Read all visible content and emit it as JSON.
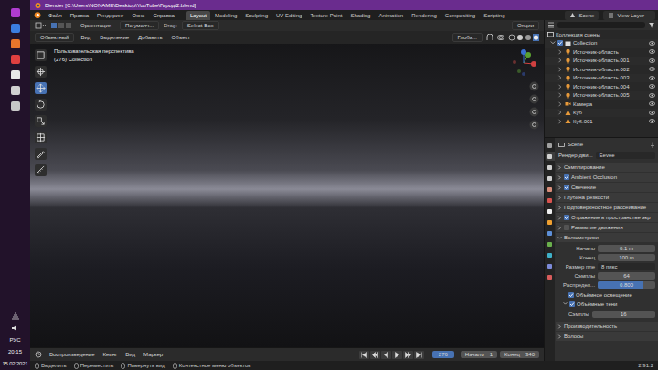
{
  "taskbar": {
    "language": "РУС",
    "time": "20:15",
    "date": "15.02.2021"
  },
  "window": {
    "title": "Blender [C:\\Users\\NONAME\\Desktop\\YouTube\\Город\\2.blend]"
  },
  "menu": [
    "Файл",
    "Правка",
    "Рендеринг",
    "Окно",
    "Справка"
  ],
  "workspaces": [
    {
      "label": "Layout",
      "selected": true
    },
    {
      "label": "Modeling",
      "selected": false
    },
    {
      "label": "Sculpting",
      "selected": false
    },
    {
      "label": "UV Editing",
      "selected": false
    },
    {
      "label": "Texture Paint",
      "selected": false
    },
    {
      "label": "Shading",
      "selected": false
    },
    {
      "label": "Animation",
      "selected": false
    },
    {
      "label": "Rendering",
      "selected": false
    },
    {
      "label": "Compositing",
      "selected": false
    },
    {
      "label": "Scripting",
      "selected": false
    }
  ],
  "scene": "Scene",
  "view_layer": "View Layer",
  "tool_header": {
    "orientation_label": "Ориентация",
    "orientation": "По умолч...",
    "drag_label": "Drag:",
    "drag": "Select Box",
    "options": "Опции"
  },
  "viewport_header": {
    "mode": "Объектный",
    "menus": [
      "Вид",
      "Выделение",
      "Добавить",
      "Объект"
    ],
    "transform": "Глоба..."
  },
  "viewport": {
    "view_name": "Пользовательская перспектива",
    "collection": "(276) Collection"
  },
  "tools": [
    {
      "selected": false
    },
    {
      "selected": false
    },
    {
      "selected": true
    },
    {
      "selected": false
    },
    {
      "selected": false
    },
    {
      "selected": false
    },
    {
      "selected": false
    },
    {
      "selected": false
    }
  ],
  "outliner": {
    "title": "Коллекция сцены",
    "collection": {
      "name": "Collection",
      "checked": true,
      "expanded": true
    },
    "items": [
      {
        "name": "Источник-область",
        "kind": "light"
      },
      {
        "name": "Источник-область.001",
        "kind": "light"
      },
      {
        "name": "Источник-область.002",
        "kind": "light"
      },
      {
        "name": "Источник-область.003",
        "kind": "light"
      },
      {
        "name": "Источник-область.004",
        "kind": "light"
      },
      {
        "name": "Источник-область.005",
        "kind": "light"
      },
      {
        "name": "Камера",
        "kind": "camera"
      },
      {
        "name": "Куб",
        "kind": "mesh"
      },
      {
        "name": "Куб.001",
        "kind": "mesh"
      }
    ]
  },
  "properties": {
    "tabs": [
      {
        "selected": false
      },
      {
        "selected": true
      },
      {
        "selected": false
      },
      {
        "selected": false
      },
      {
        "selected": false
      },
      {
        "selected": false
      },
      {
        "selected": false
      },
      {
        "selected": false
      },
      {
        "selected": false
      },
      {
        "selected": false
      },
      {
        "selected": false
      },
      {
        "selected": false
      },
      {
        "selected": false
      }
    ],
    "context": "Scene",
    "engine_label": "Рендер-дви...",
    "engine": "Eevee",
    "sections": [
      {
        "label": "Сэмплирование",
        "kind": "plain",
        "expanded": false
      },
      {
        "label": "Ambient Occlusion",
        "kind": "toggle",
        "checked": true,
        "expanded": false
      },
      {
        "label": "Свечение",
        "kind": "toggle",
        "checked": true,
        "expanded": false
      },
      {
        "label": "Глубина резкости",
        "kind": "plain",
        "expanded": false
      },
      {
        "label": "Подповерхностное рассеивание",
        "kind": "plain",
        "expanded": false
      },
      {
        "label": "Отражение в пространстве экр",
        "kind": "toggle",
        "checked": true,
        "expanded": false
      },
      {
        "label": "Размытие движения",
        "kind": "toggle",
        "checked": false,
        "expanded": false
      },
      {
        "label": "Волюметрики",
        "kind": "plain",
        "expanded": true
      },
      {
        "label": "Производительность",
        "kind": "plain",
        "expanded": false
      },
      {
        "label": "Волосы",
        "kind": "plain",
        "expanded": false
      }
    ],
    "volumetrics": {
      "fields": [
        {
          "label": "Начало",
          "value": "0.1 m",
          "kind": "number"
        },
        {
          "label": "Конец",
          "value": "100 m",
          "kind": "number"
        },
        {
          "label": "Размер пле",
          "value": "8 пикс",
          "kind": "select"
        },
        {
          "label": "Сэмплы",
          "value": "64",
          "kind": "number"
        },
        {
          "label": "Распредел...",
          "value": "0.800",
          "kind": "slider",
          "level": 0.8
        }
      ],
      "options": [
        {
          "label": "Объёмное освещение",
          "kind": "check",
          "checked": true
        },
        {
          "label": "Объёмные тени",
          "kind": "subpanel",
          "checked": true,
          "expanded": true
        }
      ],
      "shadow_samples": {
        "label": "Сэмплы",
        "value": "16"
      }
    }
  },
  "timeline": {
    "menus": [
      "Воспроизведение",
      "Кеинг",
      "Вид",
      "Маркер"
    ],
    "frame": "276",
    "start_label": "Начало",
    "start": "1",
    "end_label": "Конец",
    "end": "340"
  },
  "status_bar": {
    "items": [
      "Выделить",
      "Переместить",
      "Повернуть вид",
      "Контекстное меню объектов"
    ],
    "version": "2.91.2"
  }
}
